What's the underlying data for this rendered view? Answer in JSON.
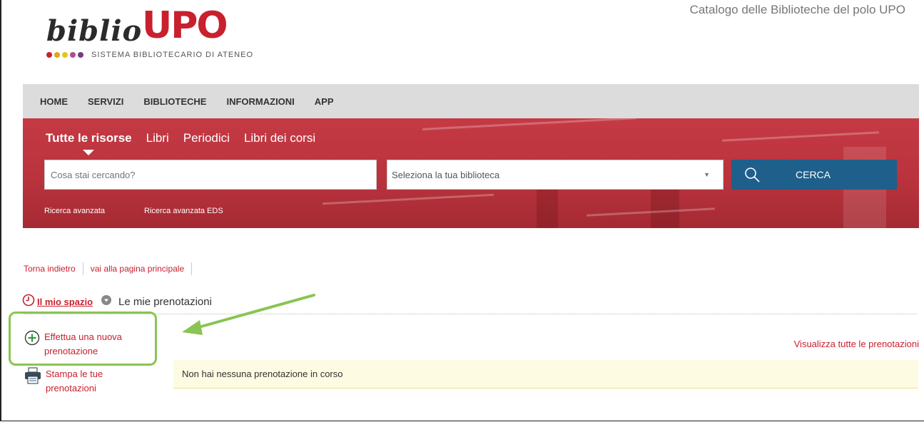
{
  "header": {
    "logo_text_biblio": "biblio",
    "logo_text_upo": "UPO",
    "logo_subtitle": "SISTEMA BIBLIOTECARIO DI ATENEO",
    "logo_dot_colors": [
      "#c8202e",
      "#e6a31c",
      "#e3c41e",
      "#b04d8a",
      "#7a3b7e"
    ],
    "catalog_title": "Catalogo delle Biblioteche del polo UPO"
  },
  "nav": {
    "items": [
      "HOME",
      "SERVIZI",
      "BIBLIOTECHE",
      "INFORMAZIONI",
      "APP"
    ]
  },
  "search": {
    "tabs": [
      "Tutte le risorse",
      "Libri",
      "Periodici",
      "Libri dei corsi"
    ],
    "active_tab": "Tutte le risorse",
    "input_placeholder": "Cosa stai cercando?",
    "library_select": "Seleziona la tua biblioteca",
    "button_label": "CERCA",
    "advanced_search": "Ricerca avanzata",
    "advanced_search_eds": "Ricerca avanzata EDS"
  },
  "breadcrumb": {
    "back": "Torna indietro",
    "main_page": "vai alla pagina principale"
  },
  "section": {
    "home_link": "Il mio spazio",
    "current": "Le mie prenotazioni"
  },
  "actions": {
    "new_reservation": "Effettua una nuova prenotazione",
    "print_reservations": "Stampa le tue prenotazioni",
    "view_all": "Visualizza tutte le prenotazioni"
  },
  "notice": {
    "message": "Non hai nessuna prenotazione in corso"
  },
  "colors": {
    "brand_red": "#c8202e",
    "search_button": "#1f5f8b",
    "highlight_green": "#8ac453"
  }
}
